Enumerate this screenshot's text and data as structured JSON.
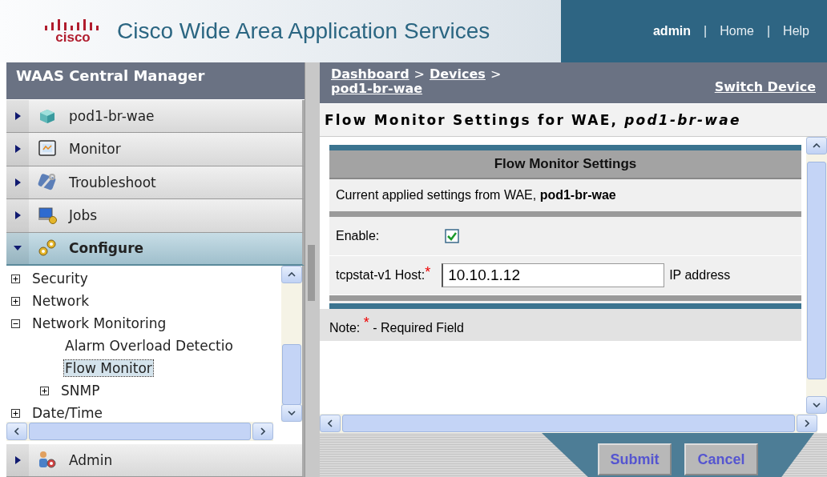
{
  "header": {
    "logo": "cisco",
    "title": "Cisco Wide Area Application Services",
    "nav": [
      {
        "label": "admin",
        "kind": "user"
      },
      {
        "label": "Home",
        "kind": "link"
      },
      {
        "label": "Help",
        "kind": "link"
      }
    ],
    "separators": [
      "|",
      "|"
    ]
  },
  "sidebar": {
    "title": "WAAS Central Manager",
    "sections": [
      {
        "label": "pod1-br-wae",
        "kind": "device",
        "expanded": false
      },
      {
        "label": "Monitor",
        "kind": "monitor",
        "expanded": false
      },
      {
        "label": "Troubleshoot",
        "kind": "troubleshoot",
        "expanded": false
      },
      {
        "label": "Jobs",
        "kind": "jobs",
        "expanded": false
      },
      {
        "label": "Configure",
        "kind": "configure",
        "expanded": true
      }
    ],
    "tree": [
      {
        "label": "Security",
        "expanded": false,
        "selected": false
      },
      {
        "label": "Network",
        "expanded": false,
        "selected": false
      },
      {
        "label": "Network Monitoring",
        "expanded": true,
        "selected": false,
        "children": [
          {
            "label": "Alarm Overload Detectio",
            "selected": false
          },
          {
            "label": "Flow Monitor",
            "selected": true
          },
          {
            "label": "SNMP",
            "expanded": false,
            "selected": false
          }
        ]
      },
      {
        "label": "Date/Time",
        "expanded": false,
        "selected": false
      }
    ],
    "footer_section": {
      "label": "Admin",
      "kind": "admin",
      "expanded": false
    }
  },
  "breadcrumb": {
    "items": [
      "Dashboard",
      "Devices",
      "pod1-br-wae"
    ],
    "separators": [
      ">",
      ">"
    ],
    "switch_link": "Switch Device"
  },
  "page_title": "Flow Monitor Settings for WAE, *pod1-br-wae*",
  "form": {
    "header": "Flow Monitor Settings",
    "info": "Current applied settings from WAE, **pod1-br-wae**",
    "enable": {
      "label": "Enable:",
      "checked": true
    },
    "host": {
      "label": "tcpstat-v1 Host:",
      "required": "*",
      "value": "10.10.1.12",
      "suffix": "IP address"
    },
    "note": "Note: $^{*}$ - Required Field"
  },
  "buttons": [
    "Submit",
    "Cancel"
  ]
}
